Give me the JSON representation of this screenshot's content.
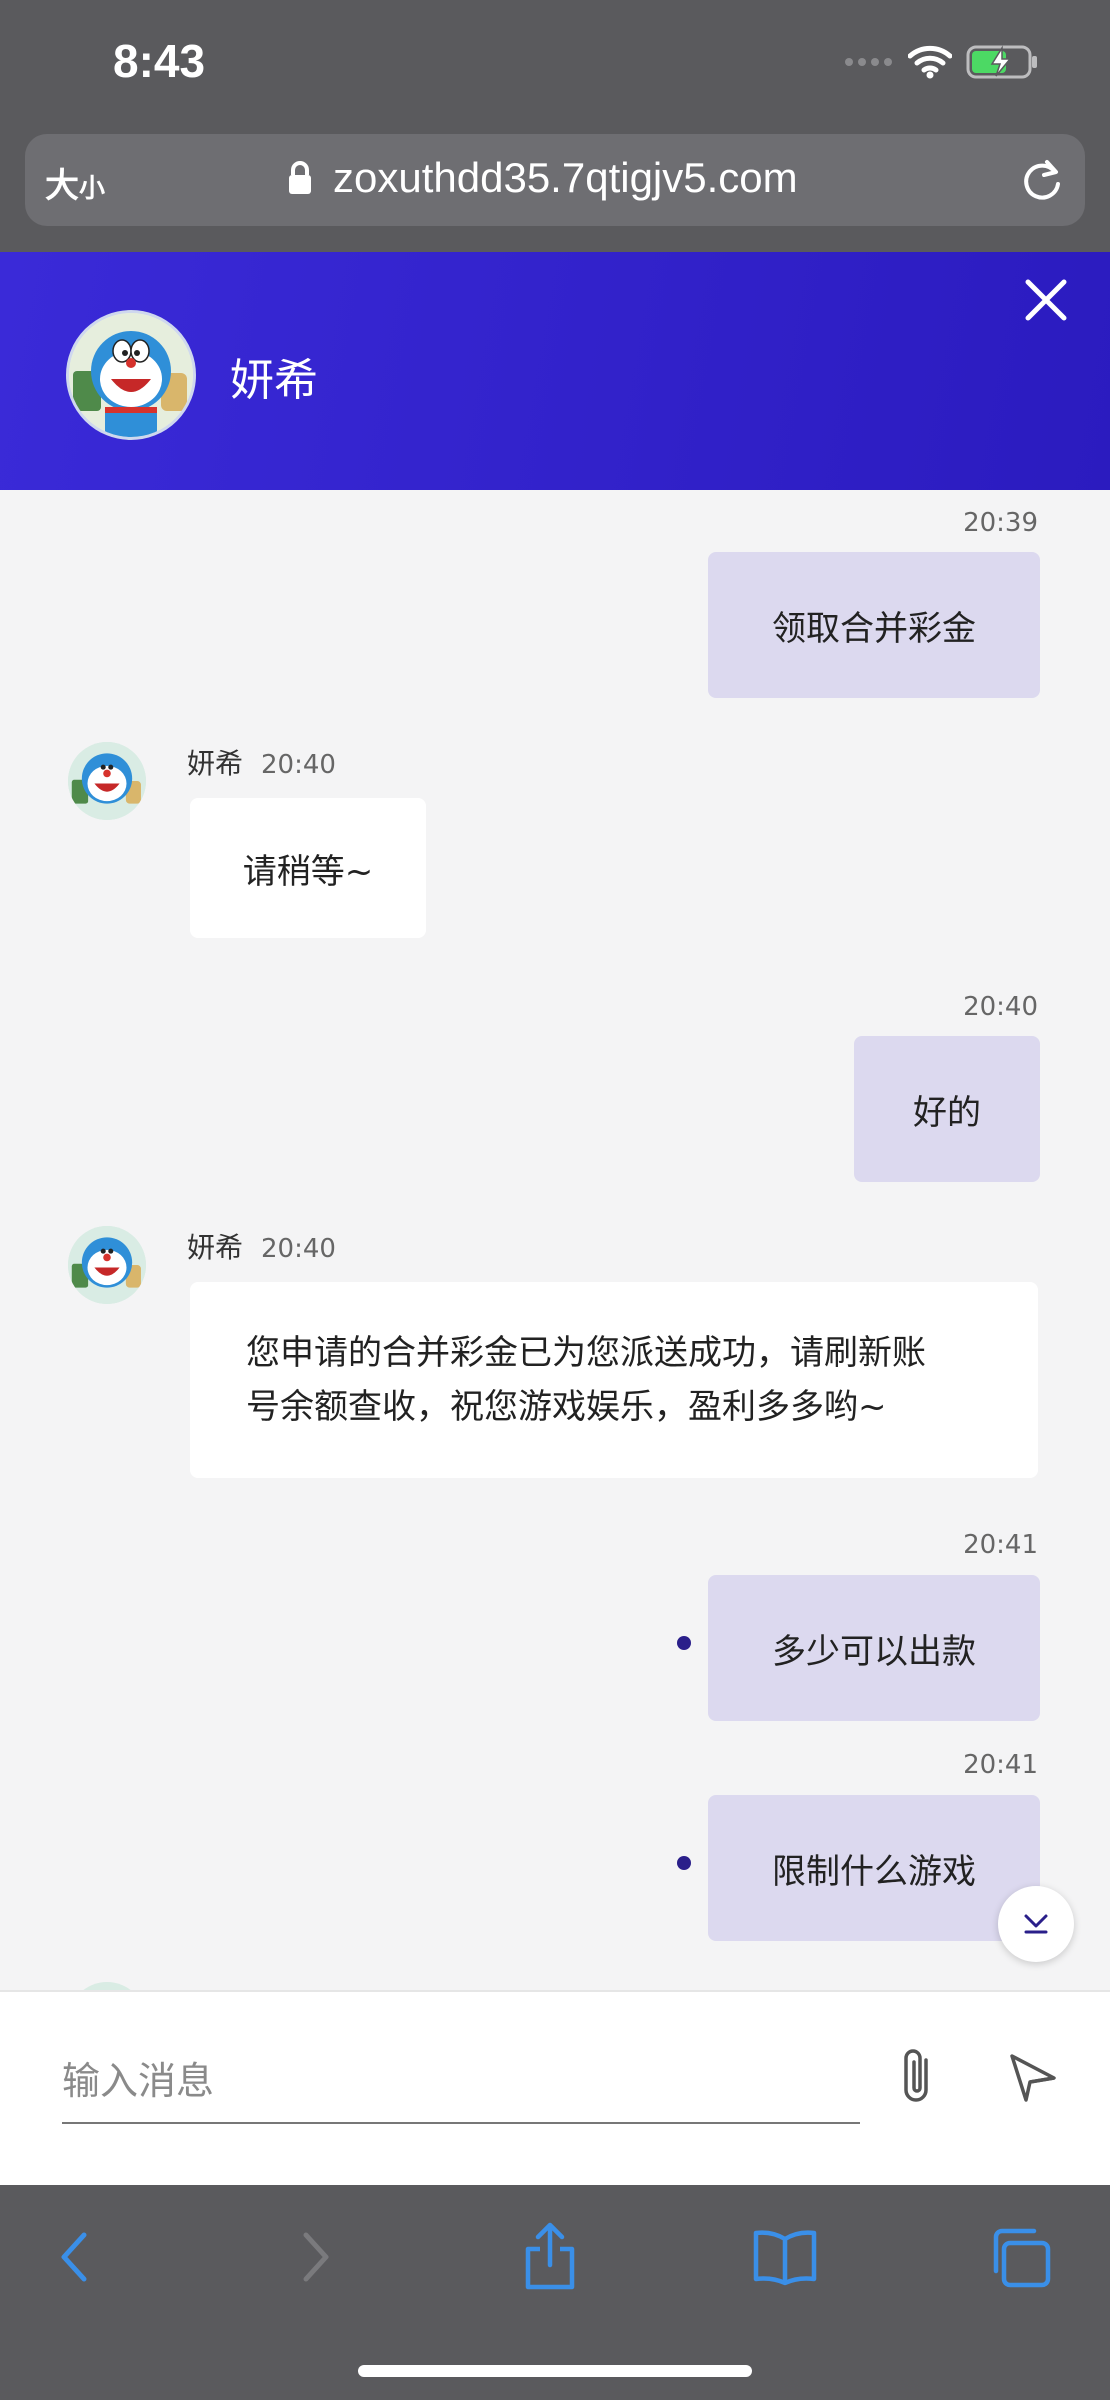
{
  "status_bar": {
    "time": "8:43"
  },
  "browser": {
    "text_size_big": "大",
    "text_size_small": "小",
    "url": "zoxuthdd35.7qtigjv5.com"
  },
  "header": {
    "agent_name": "妍希"
  },
  "messages": [
    {
      "direction": "out",
      "time": "20:39",
      "text": "领取合并彩金"
    },
    {
      "direction": "in",
      "name": "妍希",
      "time": "20:40",
      "text": "请稍等~"
    },
    {
      "direction": "out",
      "time": "20:40",
      "text": "好的"
    },
    {
      "direction": "in",
      "name": "妍希",
      "time": "20:40",
      "text_line1": "您申请的合并彩金已为您派送成功，请刷新账",
      "text_line2": "号余额查收，祝您游戏娱乐，盈利多多哟~"
    },
    {
      "direction": "out",
      "time": "20:41",
      "text": "多少可以出款",
      "unread": true
    },
    {
      "direction": "out",
      "time": "20:41",
      "text": "限制什么游戏",
      "unread": true
    }
  ],
  "input": {
    "placeholder": "输入消息"
  },
  "colors": {
    "header": "#3a2ad8",
    "outgoing_bubble": "#dcd9ef",
    "browser_chrome": "#5a5a5d",
    "nav_icon": "#3a8fe8"
  }
}
